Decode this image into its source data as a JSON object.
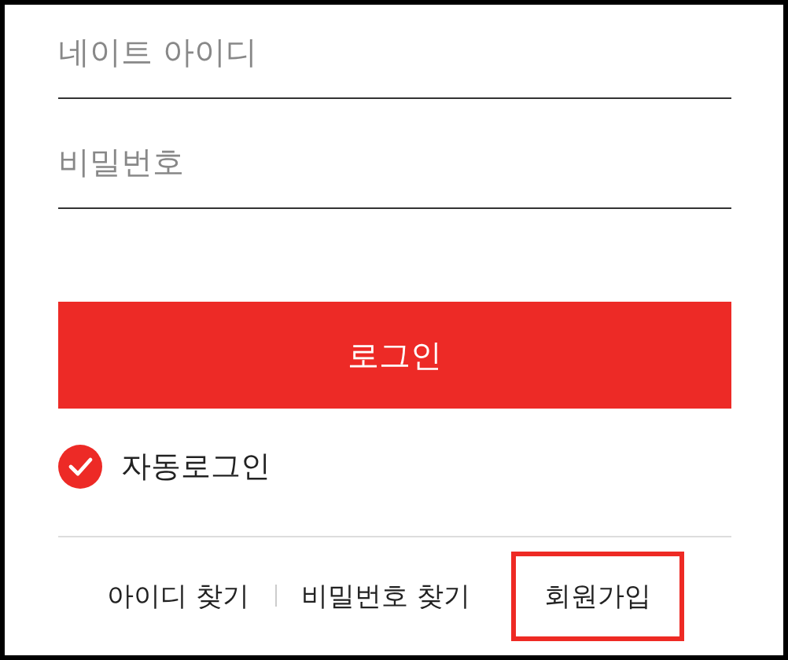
{
  "fields": [
    {
      "placeholder": "네이트 아이디"
    },
    {
      "placeholder": "비밀번호"
    }
  ],
  "login_button": "로그인",
  "auto_login": {
    "label": "자동로그인",
    "checked": true
  },
  "links": [
    {
      "label": "아이디 찾기",
      "highlighted": false
    },
    {
      "label": "비밀번호 찾기",
      "highlighted": false
    },
    {
      "label": "회원가입",
      "highlighted": true
    }
  ]
}
